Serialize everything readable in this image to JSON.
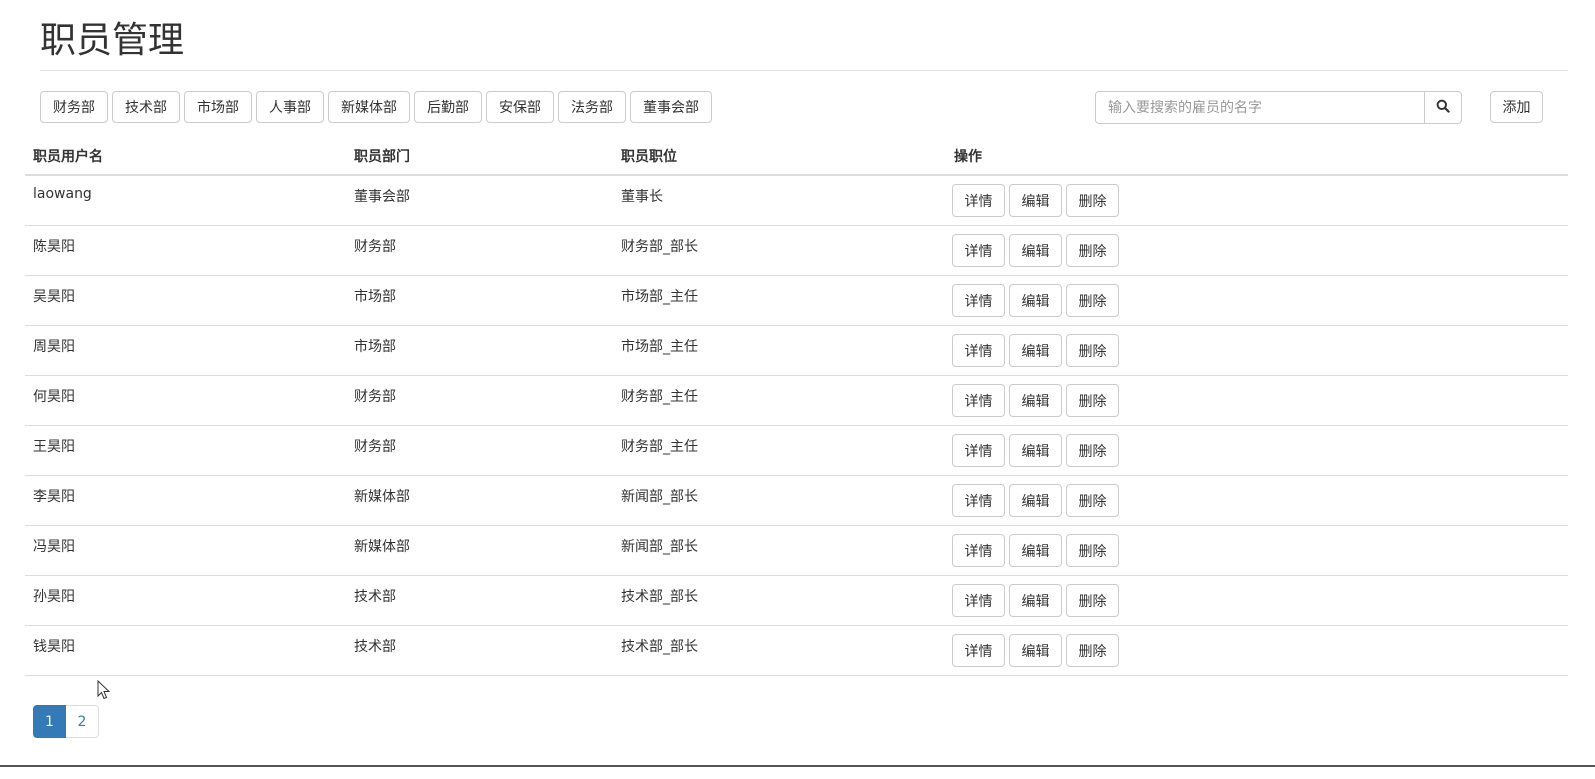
{
  "header": {
    "title": "职员管理"
  },
  "departments": [
    "财务部",
    "技术部",
    "市场部",
    "人事部",
    "新媒体部",
    "后勤部",
    "安保部",
    "法务部",
    "董事会部"
  ],
  "search": {
    "placeholder": "输入要搜索的雇员的名字",
    "value": "",
    "icon": "search-icon"
  },
  "toolbar": {
    "add_label": "添加"
  },
  "table": {
    "headers": {
      "username": "职员用户名",
      "department": "职员部门",
      "position": "职员职位",
      "actions": "操作"
    },
    "action_labels": {
      "detail": "详情",
      "edit": "编辑",
      "delete": "删除"
    },
    "rows": [
      {
        "username": "laowang",
        "department": "董事会部",
        "position": "董事长"
      },
      {
        "username": "陈昊阳",
        "department": "财务部",
        "position": "财务部_部长"
      },
      {
        "username": "吴昊阳",
        "department": "市场部",
        "position": "市场部_主任"
      },
      {
        "username": "周昊阳",
        "department": "市场部",
        "position": "市场部_主任"
      },
      {
        "username": "何昊阳",
        "department": "财务部",
        "position": "财务部_主任"
      },
      {
        "username": "王昊阳",
        "department": "财务部",
        "position": "财务部_主任"
      },
      {
        "username": "李昊阳",
        "department": "新媒体部",
        "position": "新闻部_部长"
      },
      {
        "username": "冯昊阳",
        "department": "新媒体部",
        "position": "新闻部_部长"
      },
      {
        "username": "孙昊阳",
        "department": "技术部",
        "position": "技术部_部长"
      },
      {
        "username": "钱昊阳",
        "department": "技术部",
        "position": "技术部_部长"
      }
    ]
  },
  "pagination": {
    "pages": [
      "1",
      "2"
    ],
    "current": "1"
  },
  "colors": {
    "primary": "#337ab7",
    "border": "#cccccc",
    "row_border": "#dddddd"
  }
}
